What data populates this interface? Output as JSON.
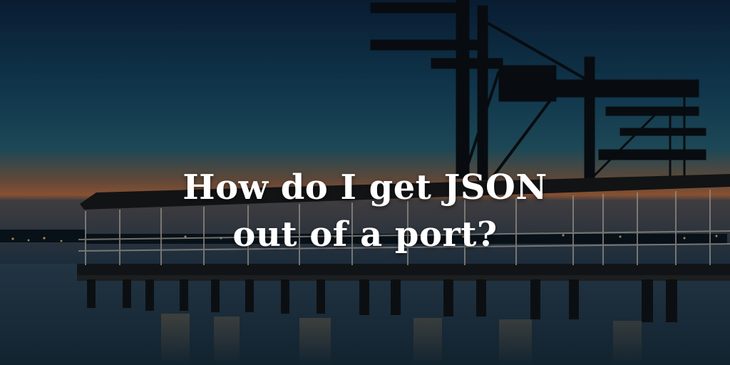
{
  "headline": {
    "line1": "How do I get JSON",
    "line2": "out of a port?"
  },
  "colors": {
    "sky_top": "#0f2d4c",
    "sky_mid": "#1f5c7a",
    "horizon": "#c9774a",
    "water": "#2a4f6a",
    "silhouette": "#0b1116",
    "text": "#ffffff"
  }
}
